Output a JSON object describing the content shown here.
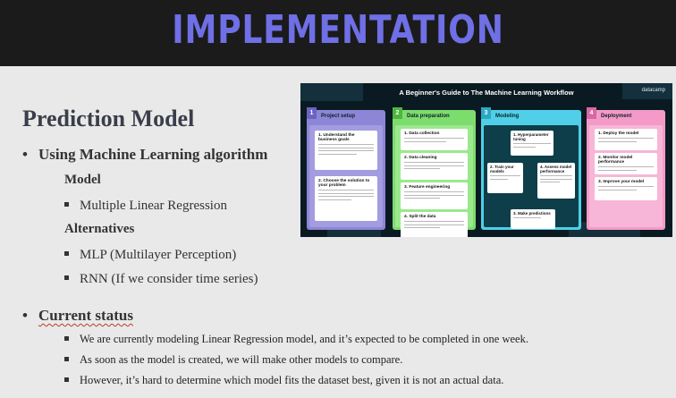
{
  "header": {
    "title": "IMPLEMENTATION"
  },
  "section_title": "Prediction Model",
  "ml": {
    "heading": "Using Machine Learning algorithm",
    "model_label": "Model",
    "model_items": [
      "Multiple Linear Regression"
    ],
    "alt_label": "Alternatives",
    "alt_items": [
      "MLP (Multilayer Perception)",
      "RNN (If we consider time series)"
    ]
  },
  "status": {
    "heading": "Current status",
    "items": [
      "We are currently modeling Linear Regression model, and it’s expected to be completed in one week.",
      "As soon as the model is created, we will make other models to compare.",
      "However, it’s hard to determine which model fits the dataset best, given it is not an actual data."
    ]
  },
  "infographic": {
    "title": "A Beginner's Guide to The Machine Learning Workflow",
    "brand": "datacamp",
    "columns": [
      {
        "num": "1",
        "title": "Project setup",
        "color": "#8d86d6",
        "cards": [
          "1. Understand the business goals",
          "2. Choose the solution to your problem"
        ]
      },
      {
        "num": "2",
        "title": "Data preparation",
        "color": "#7ddc6e",
        "cards": [
          "1. Data collection",
          "2. Data cleaning",
          "3. Feature engineering",
          "4. Split the data"
        ]
      },
      {
        "num": "3",
        "title": "Modeling",
        "color": "#4fd0e8",
        "cards": [
          "1. Hyperparameter tuning",
          "2. Train your models",
          "4. Assess model performance",
          "3. Make predictions"
        ]
      },
      {
        "num": "4",
        "title": "Deployment",
        "color": "#f49ac8",
        "cards": [
          "1. Deploy the model",
          "2. Monitor model performance",
          "3. Improve your model"
        ]
      }
    ]
  }
}
